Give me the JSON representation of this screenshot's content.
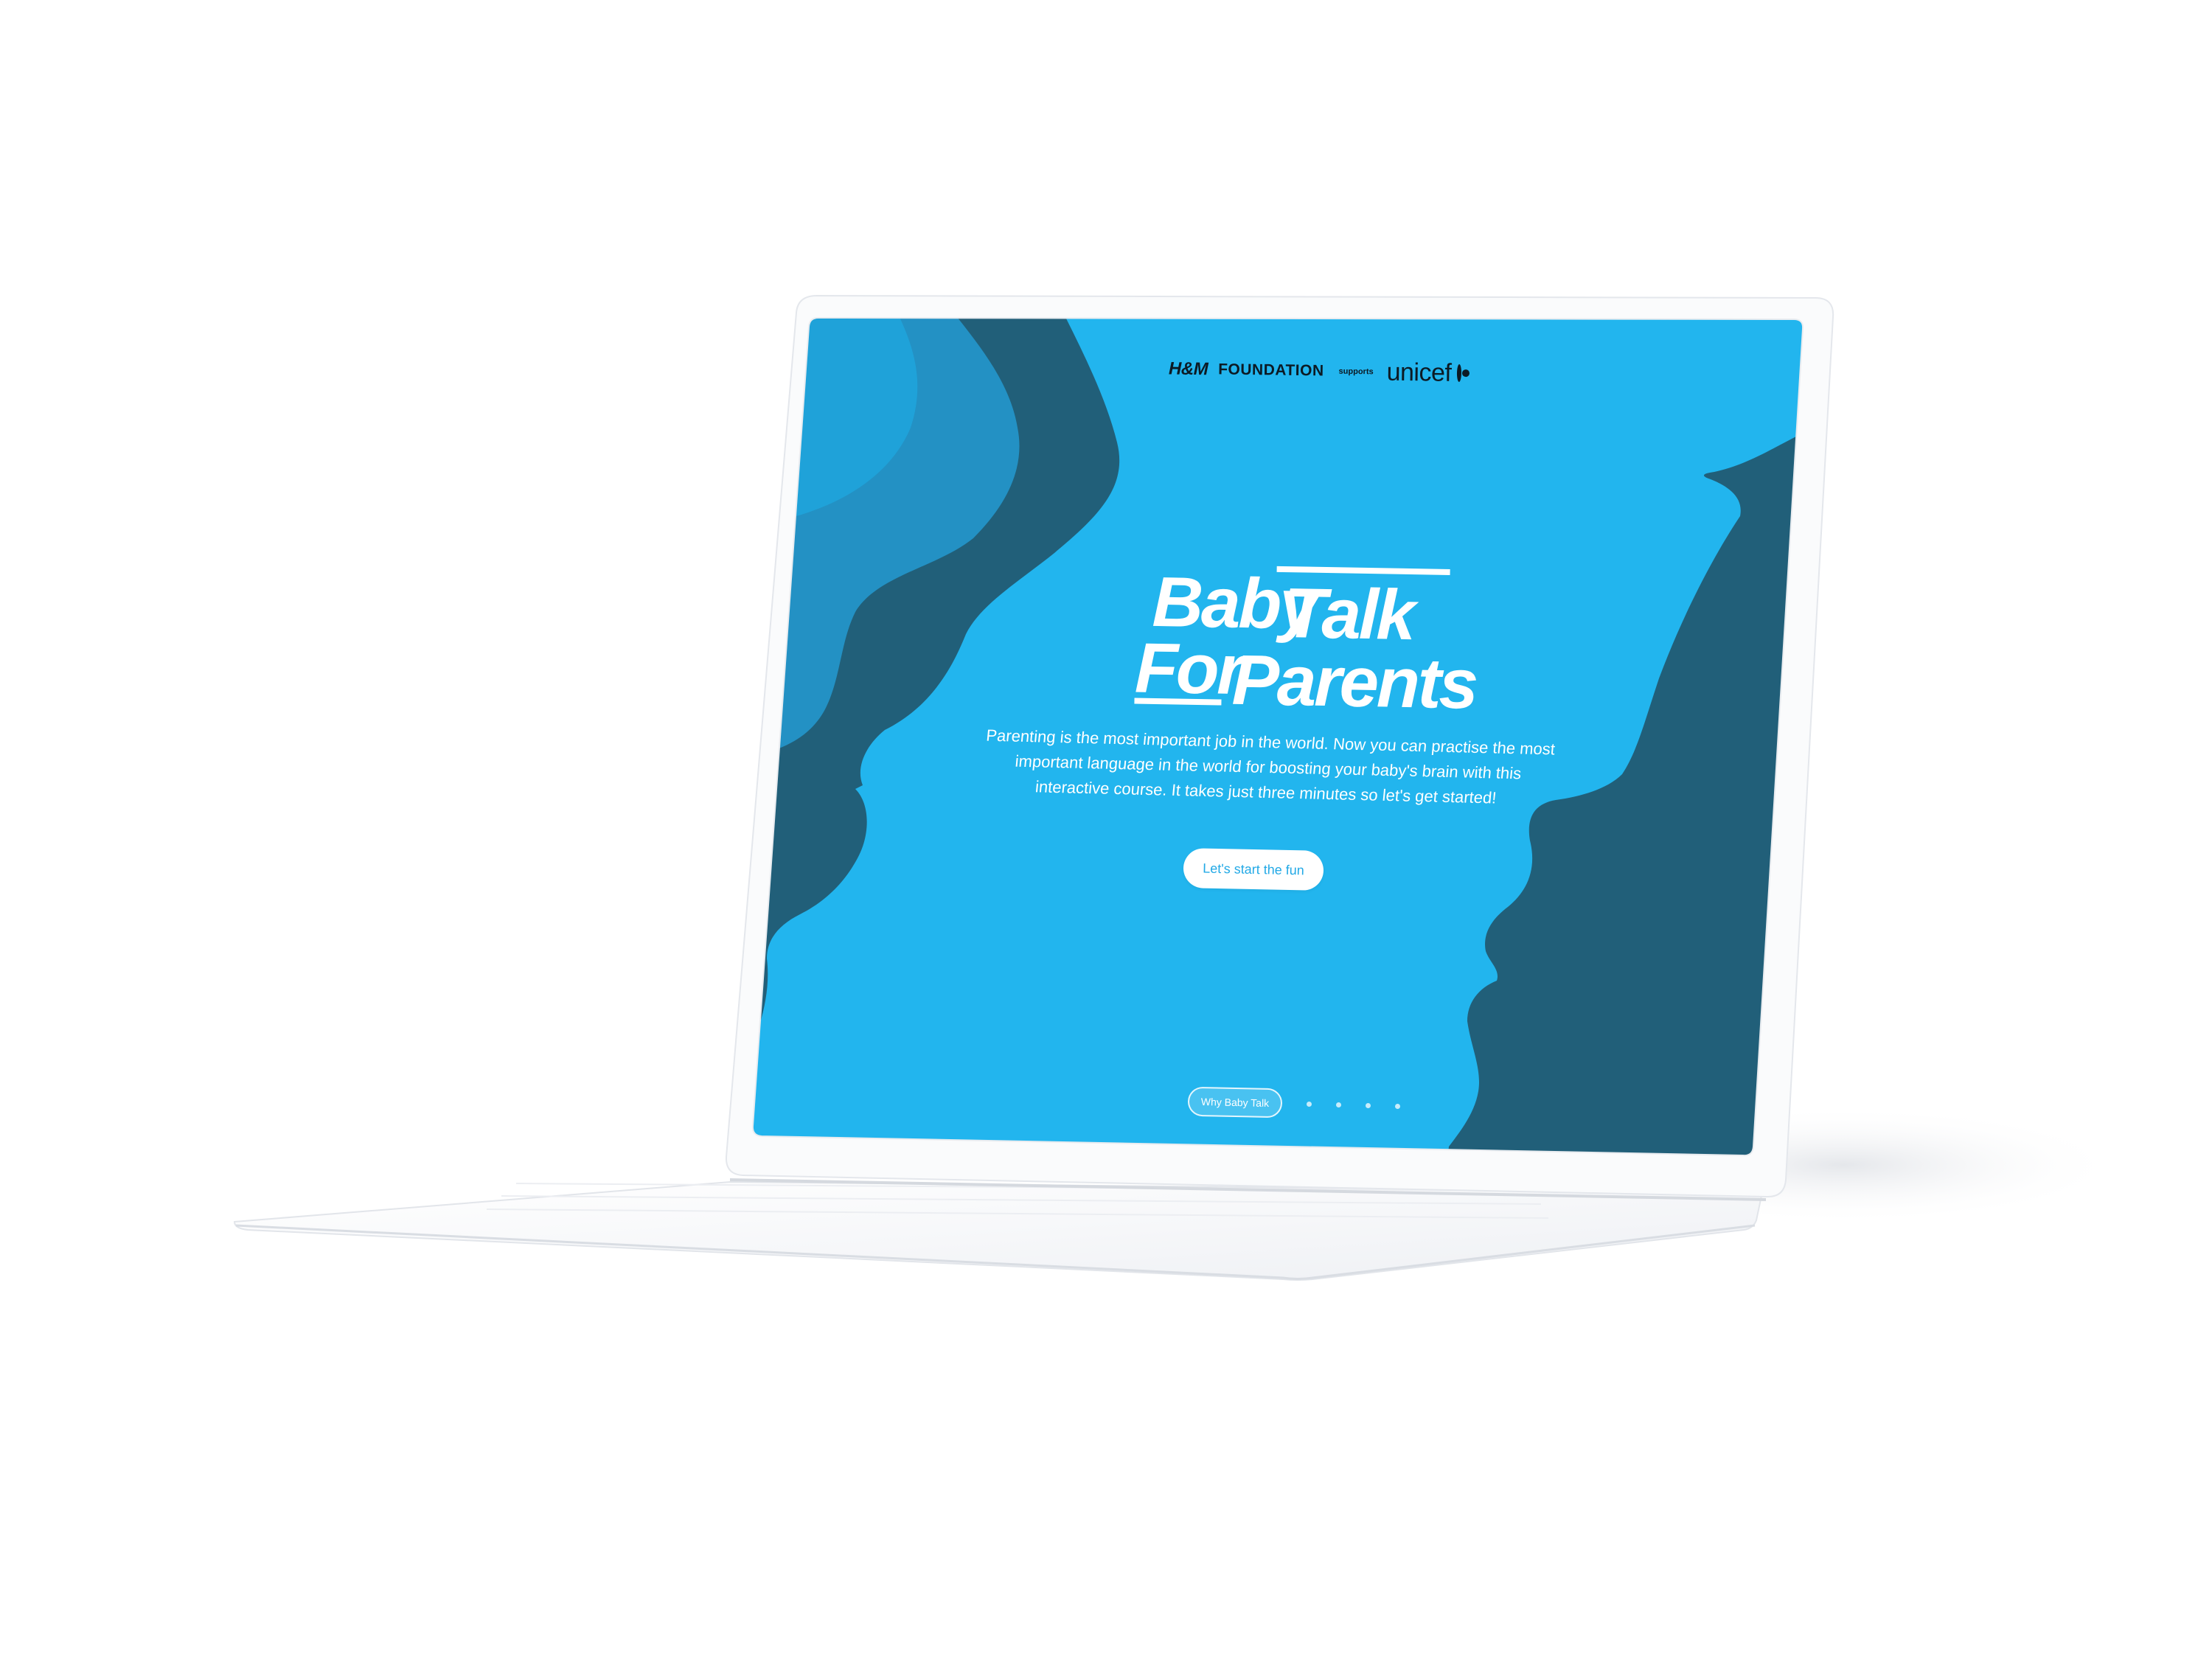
{
  "header": {
    "brand_hm": "H&M",
    "brand_foundation": "FOUNDATION",
    "brand_supports": "supports",
    "brand_unicef": "unicef"
  },
  "hero": {
    "title_word_1": "Baby",
    "title_word_2": "Talk",
    "title_word_3": "For",
    "title_word_4": "Parents",
    "intro": "Parenting is the most important job in the world. Now you can practise the most important language in the world for boosting your baby's brain with this interactive course. It takes just three minutes so let's get started!",
    "cta_label": "Let's start the fun"
  },
  "bottom_nav": {
    "pill_label": "Why Baby Talk",
    "dot_count": 4,
    "active_index": 0
  },
  "colors": {
    "background_blue": "#22b5ee",
    "mid_blue": "#2391c4",
    "dark_teal": "#215f79",
    "device_white": "#f7f8fa"
  },
  "icons": {
    "globe": "unicef-globe-icon"
  }
}
